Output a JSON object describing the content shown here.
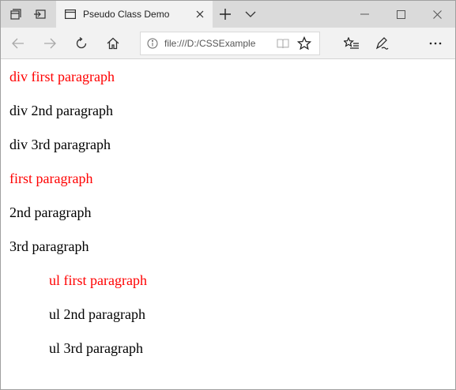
{
  "browser": {
    "tab_title": "Pseudo Class Demo",
    "address_url": "file:///D:/CSSExample",
    "icons": {
      "tab_actions": "tab-actions-icon",
      "set_aside": "set-aside-tabs-icon",
      "favicon": "page-favicon-icon",
      "close_tab": "close-icon",
      "new_tab": "plus-icon",
      "tabs_menu": "chevron-down-icon",
      "minimize": "minimize-icon",
      "maximize": "maximize-icon",
      "close_window": "close-icon",
      "back": "arrow-left-icon",
      "forward": "arrow-right-icon",
      "refresh": "refresh-icon",
      "home": "home-icon",
      "info": "info-icon",
      "reading_view": "reading-view-icon",
      "favorite": "star-icon",
      "favorites_hub": "favorites-list-icon",
      "notes": "pen-icon",
      "more": "more-icon"
    }
  },
  "page": {
    "paragraphs": [
      {
        "text": "div first paragraph",
        "color": "#ff0000"
      },
      {
        "text": "div 2nd paragraph",
        "color": "#000000"
      },
      {
        "text": "div 3rd paragraph",
        "color": "#000000"
      },
      {
        "text": "first paragraph",
        "color": "#ff0000"
      },
      {
        "text": "2nd paragraph",
        "color": "#000000"
      },
      {
        "text": "3rd paragraph",
        "color": "#000000"
      },
      {
        "text": "ul first paragraph",
        "color": "#ff0000"
      },
      {
        "text": "ul 2nd paragraph",
        "color": "#000000"
      },
      {
        "text": "ul 3rd paragraph",
        "color": "#000000"
      }
    ]
  }
}
